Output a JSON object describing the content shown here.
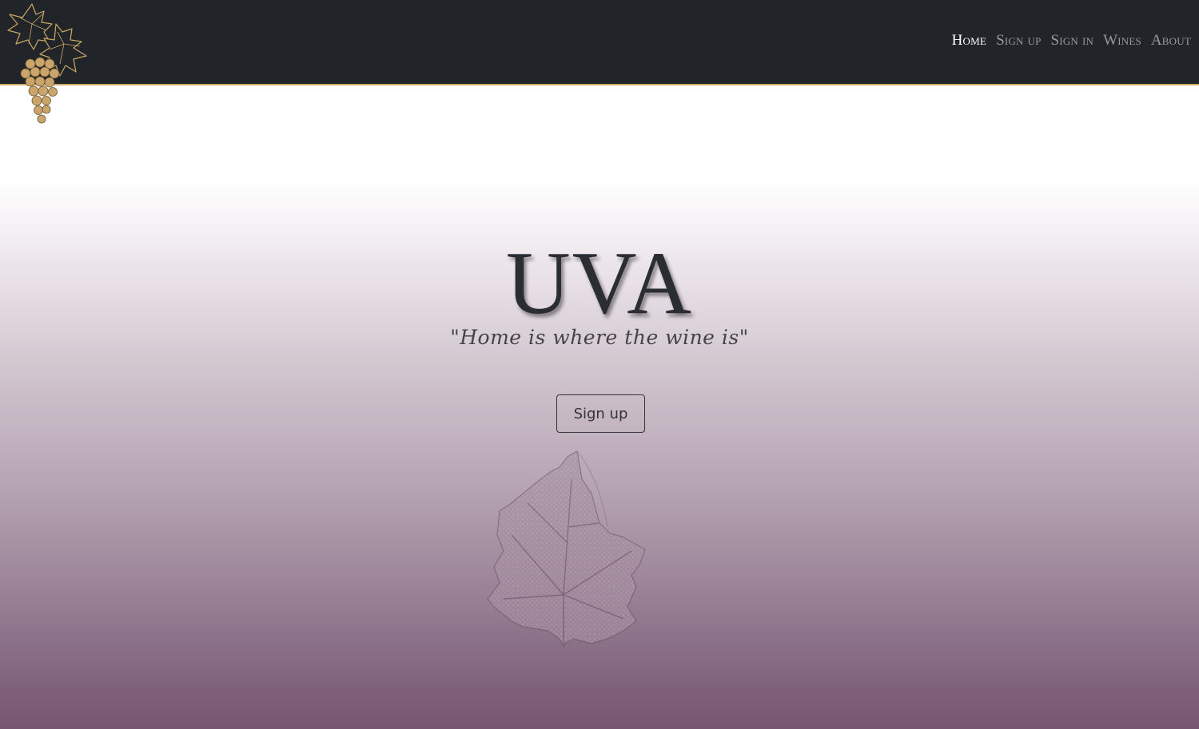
{
  "brand": {
    "logo_icon": "grape-cluster-icon",
    "accent_color": "#c9a865"
  },
  "nav": {
    "items": [
      {
        "label": "Home",
        "active": true
      },
      {
        "label": "Sign up",
        "active": false
      },
      {
        "label": "Sign in",
        "active": false
      },
      {
        "label": "Wines",
        "active": false
      },
      {
        "label": "About",
        "active": false
      }
    ]
  },
  "hero": {
    "title": "UVA",
    "tagline": "\"Home is where the wine is\"",
    "cta_label": "Sign up",
    "decoration_icon": "vine-leaf-icon"
  },
  "colors": {
    "navbar_bg": "#212428",
    "gradient_bottom": "#77576f"
  }
}
